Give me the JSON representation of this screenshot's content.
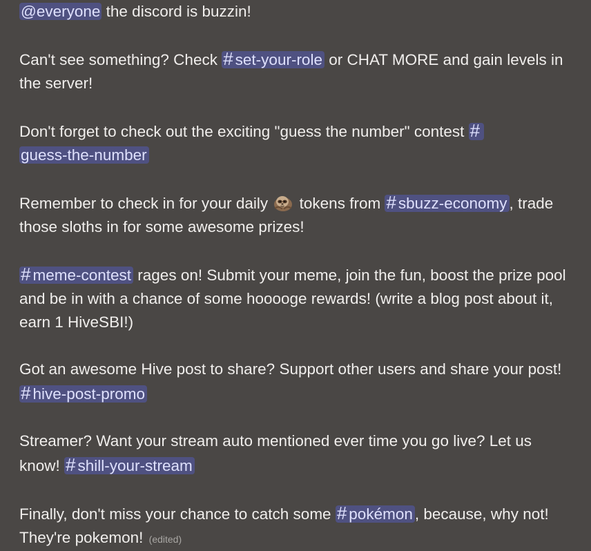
{
  "message": {
    "p1": {
      "mention": "@everyone",
      "text": " the discord is buzzin!"
    },
    "p2": {
      "pre": "Can't see something? Check ",
      "channel": "set-your-role",
      "post": " or CHAT MORE and gain levels in the server!"
    },
    "p3": {
      "pre": "Don't forget to check out the exciting \"guess the number\" contest ",
      "channel": "guess-the-number"
    },
    "p4": {
      "pre": "Remember to check in for your daily ",
      "emoji": "sloth-emoji",
      "mid": " tokens from ",
      "channel": "sbuzz-economy",
      "post": ", trade those sloths in for some awesome prizes!"
    },
    "p5": {
      "channel": "meme-contest",
      "post": " rages on! Submit your meme, join the fun, boost the prize pool and be in with a chance of some hooooge rewards! (write a blog post about it, earn 1 HiveSBI!)"
    },
    "p6": {
      "pre": "Got an awesome Hive post to share? Support other users and share your post! ",
      "channel": "hive-post-promo"
    },
    "p7": {
      "pre": "Streamer? Want your stream auto mentioned ever time you go live? Let us know! ",
      "channel": "shill-your-stream"
    },
    "p8": {
      "pre": "Finally, don't miss your chance to catch some ",
      "channel": "pokémon",
      "post": ", because, why not! They're pokemon!",
      "edited": "(edited)"
    },
    "hash_symbol": "#"
  },
  "colors": {
    "background": "#4a4745",
    "text": "#f0eeec",
    "mention_bg": "rgba(88,101,242,0.35)",
    "mention_text": "#dee0fc",
    "muted": "#a9a7a4"
  }
}
